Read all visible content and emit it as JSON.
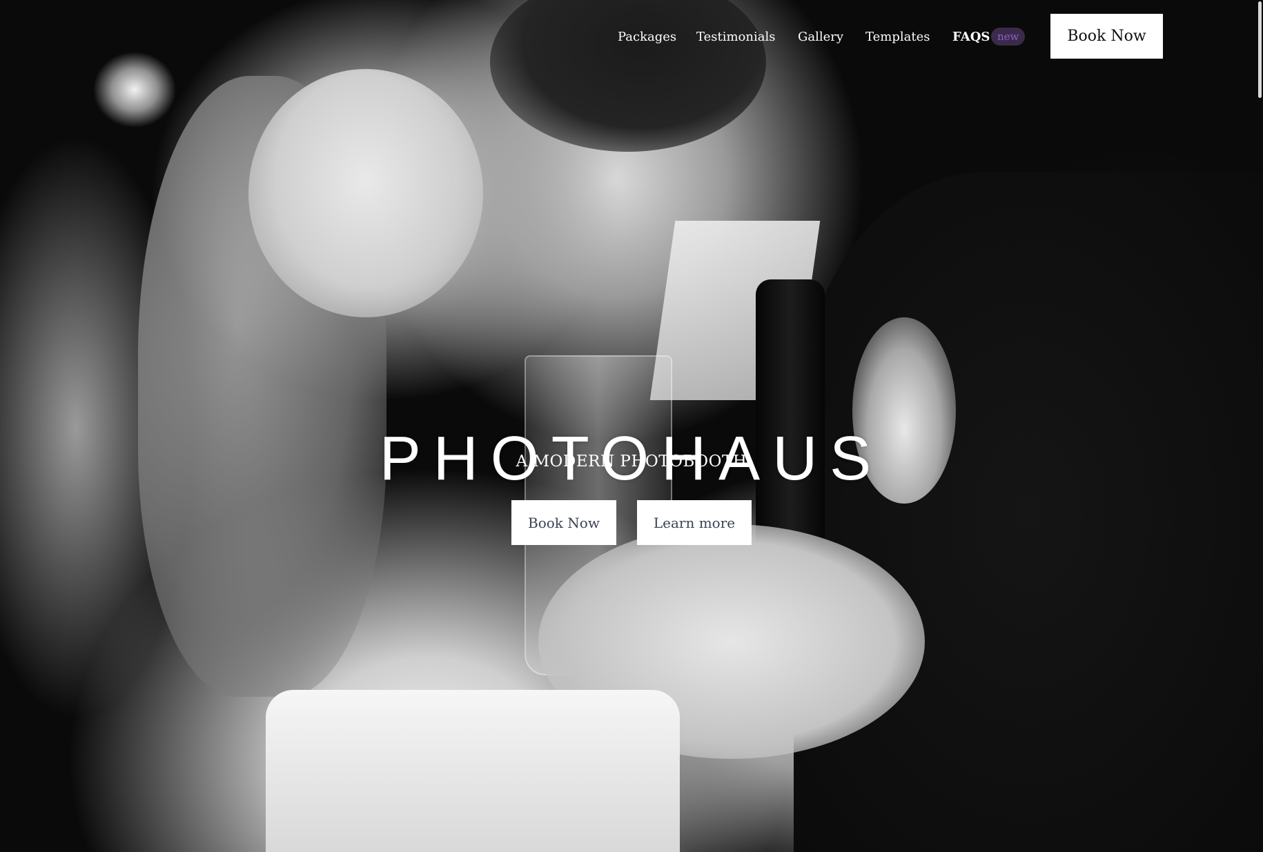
{
  "nav": {
    "links": [
      {
        "label": "Packages"
      },
      {
        "label": "Testimonials"
      },
      {
        "label": "Gallery"
      },
      {
        "label": "Templates"
      },
      {
        "label": "FAQS"
      }
    ],
    "badge": "new",
    "book_label": "Book Now"
  },
  "hero": {
    "title": "PHOTOHAUS",
    "subtitle": "A MODERN PHOTOBOOTH",
    "primary_button": "Book Now",
    "secondary_button": "Learn more"
  },
  "colors": {
    "badge_bg": "#3b2b49",
    "badge_text": "#8d5fd1",
    "button_bg": "#ffffff",
    "button_text": "#3a4254"
  }
}
